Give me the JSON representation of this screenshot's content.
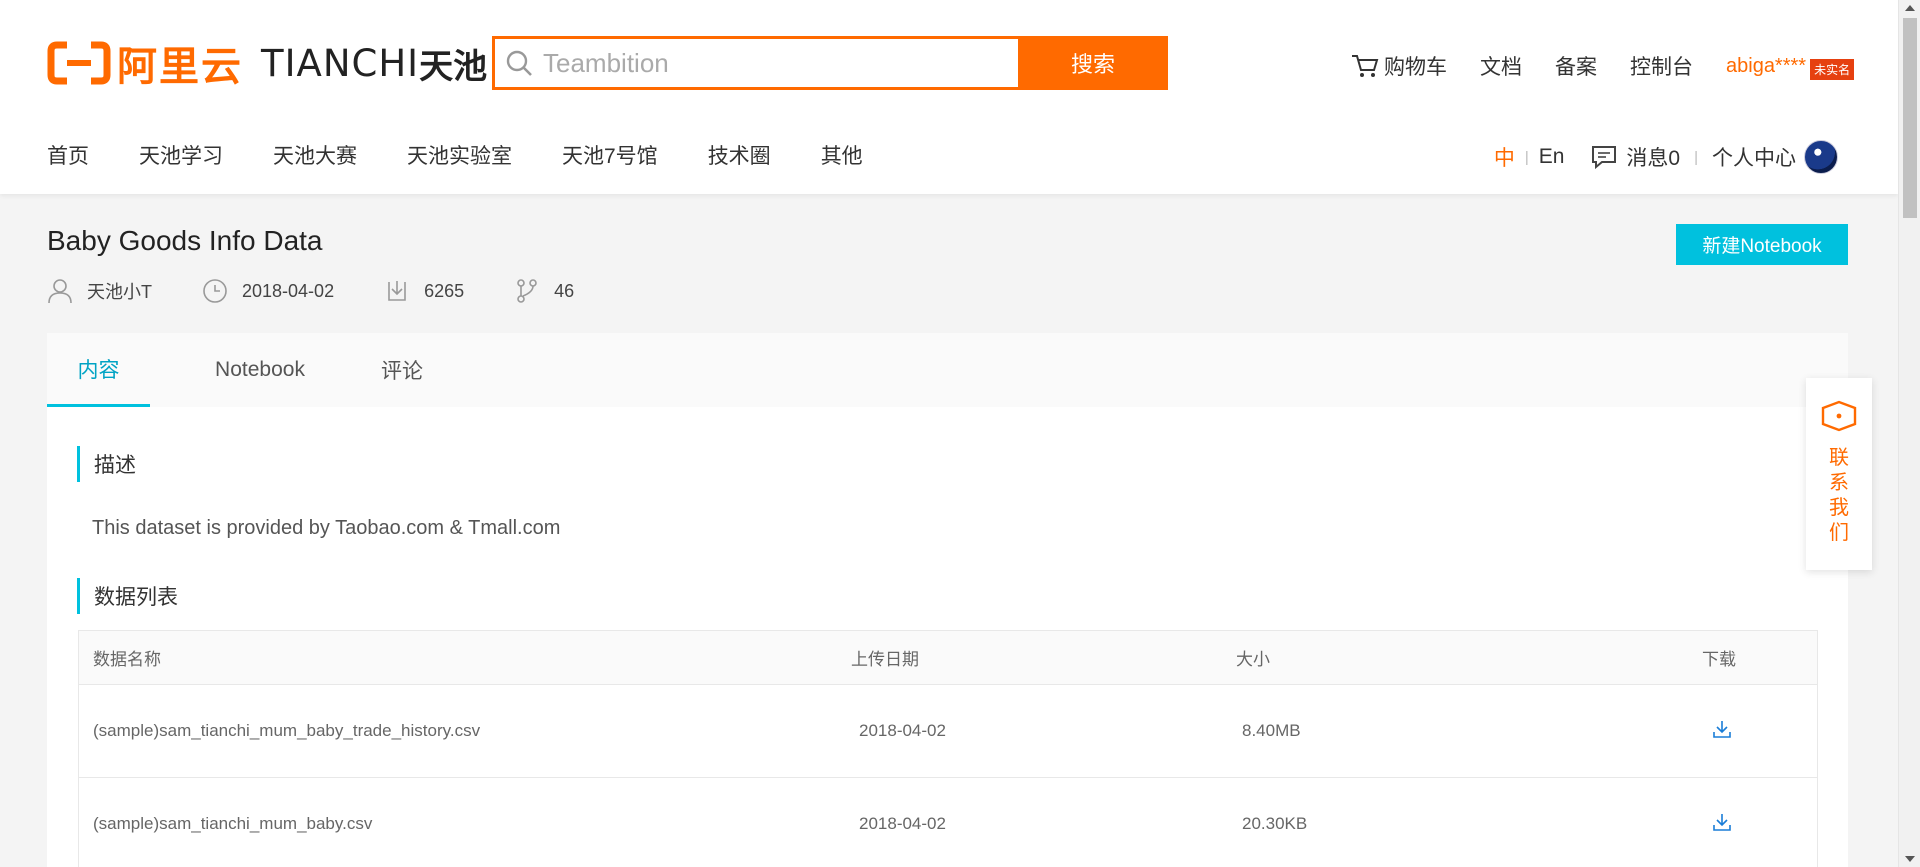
{
  "header": {
    "logo_cn": "阿里云",
    "logo_tc": "TIANCHI",
    "logo_tc_cn": "天池",
    "search_placeholder": "Teambition",
    "search_button": "搜索",
    "links": [
      "购物车",
      "文档",
      "备案",
      "控制台"
    ],
    "user": "abiga****",
    "user_badge": "未实名"
  },
  "nav": {
    "items": [
      "首页",
      "天池学习",
      "天池大赛",
      "天池实验室",
      "天池7号馆",
      "技术圈",
      "其他"
    ],
    "lang_zh": "中",
    "lang_sep": "|",
    "lang_en": "En",
    "messages": "消息0",
    "personal": "个人中心"
  },
  "dataset": {
    "title": "Baby Goods Info Data",
    "new_notebook": "新建Notebook",
    "author": "天池小T",
    "date": "2018-04-02",
    "downloads": "6265",
    "forks": "46"
  },
  "tabs": [
    "内容",
    "Notebook",
    "评论"
  ],
  "content": {
    "desc_heading": "描述",
    "description": "This dataset is provided by Taobao.com & Tmall.com",
    "list_heading": "数据列表",
    "columns": [
      "数据名称",
      "上传日期",
      "大小",
      "下载"
    ],
    "rows": [
      {
        "name": "(sample)sam_tianchi_mum_baby_trade_history.csv",
        "date": "2018-04-02",
        "size": "8.40MB"
      },
      {
        "name": "(sample)sam_tianchi_mum_baby.csv",
        "date": "2018-04-02",
        "size": "20.30KB"
      }
    ]
  },
  "contact": {
    "label": "联系我们"
  },
  "colors": {
    "brand": "#ff6a00",
    "accent": "#00c1de"
  }
}
